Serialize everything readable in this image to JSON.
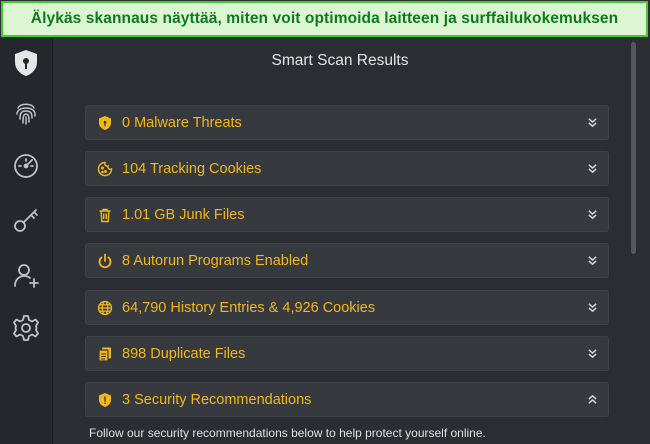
{
  "banner": {
    "caption": "Älykäs skannaus näyttää, miten voit optimoida laitteen ja surffailukokemuksen"
  },
  "sidebar": {
    "items": [
      {
        "icon": "shield-icon"
      },
      {
        "icon": "fingerprint-icon"
      },
      {
        "icon": "speedometer-icon"
      },
      {
        "icon": "key-icon"
      },
      {
        "icon": "add-user-icon"
      },
      {
        "icon": "gear-icon"
      }
    ]
  },
  "main": {
    "title": "Smart Scan Results",
    "results": [
      {
        "icon": "shield-icon",
        "label": "0 Malware Threats",
        "expanded": false
      },
      {
        "icon": "cookie-icon",
        "label": "104 Tracking Cookies",
        "expanded": false
      },
      {
        "icon": "trash-icon",
        "label": "1.01 GB Junk Files",
        "expanded": false
      },
      {
        "icon": "power-icon",
        "label": "8 Autorun Programs Enabled",
        "expanded": false
      },
      {
        "icon": "globe-icon",
        "label": "64,790 History Entries & 4,926 Cookies",
        "expanded": false
      },
      {
        "icon": "files-icon",
        "label": "898 Duplicate Files",
        "expanded": false
      },
      {
        "icon": "shield-icon",
        "label": "3 Security Recommendations",
        "expanded": true
      }
    ],
    "recommendation_text": "Follow our security recommendations below to help protect yourself online."
  },
  "colors": {
    "accent": "#f2b718",
    "banner_bg": "#dcf5d3",
    "banner_border": "#3fcf2c",
    "banner_text": "#0f7a1f"
  }
}
